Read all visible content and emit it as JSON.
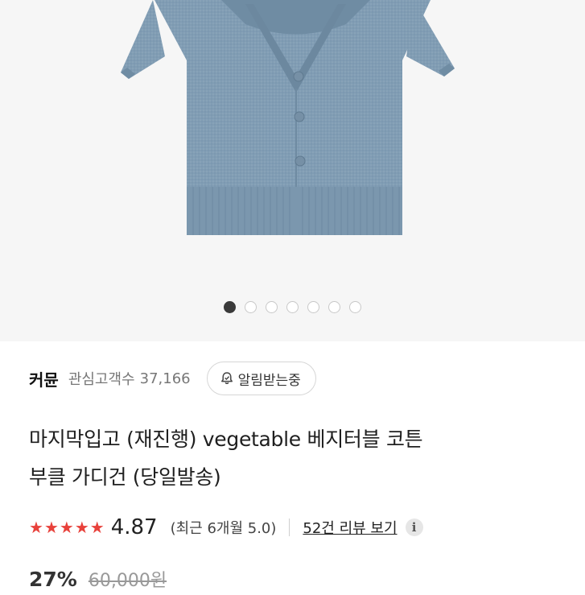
{
  "hero": {
    "image_alt": "blue knit short sleeve cardigan",
    "carousel": {
      "total": 7,
      "active_index": 0
    }
  },
  "store": {
    "name": "커뮨",
    "followers_label": "관심고객수",
    "followers_count": "37,166",
    "alarm_label": "알림받는중"
  },
  "product": {
    "title_line1": "마지막입고 (재진행) vegetable 베지터블 코튼",
    "title_line2": "부클 가디건 (당일발송)"
  },
  "rating": {
    "stars": 5,
    "value": "4.87",
    "recent_text": "(최근 6개월 5.0)",
    "review_link": "52건 리뷰 보기",
    "info_icon": "i"
  },
  "price": {
    "discount": "27%",
    "original": "60,000원"
  },
  "colors": {
    "star": "#e8413b",
    "cardigan": "#7f9bb3",
    "dot_active": "#3a3a3a"
  }
}
